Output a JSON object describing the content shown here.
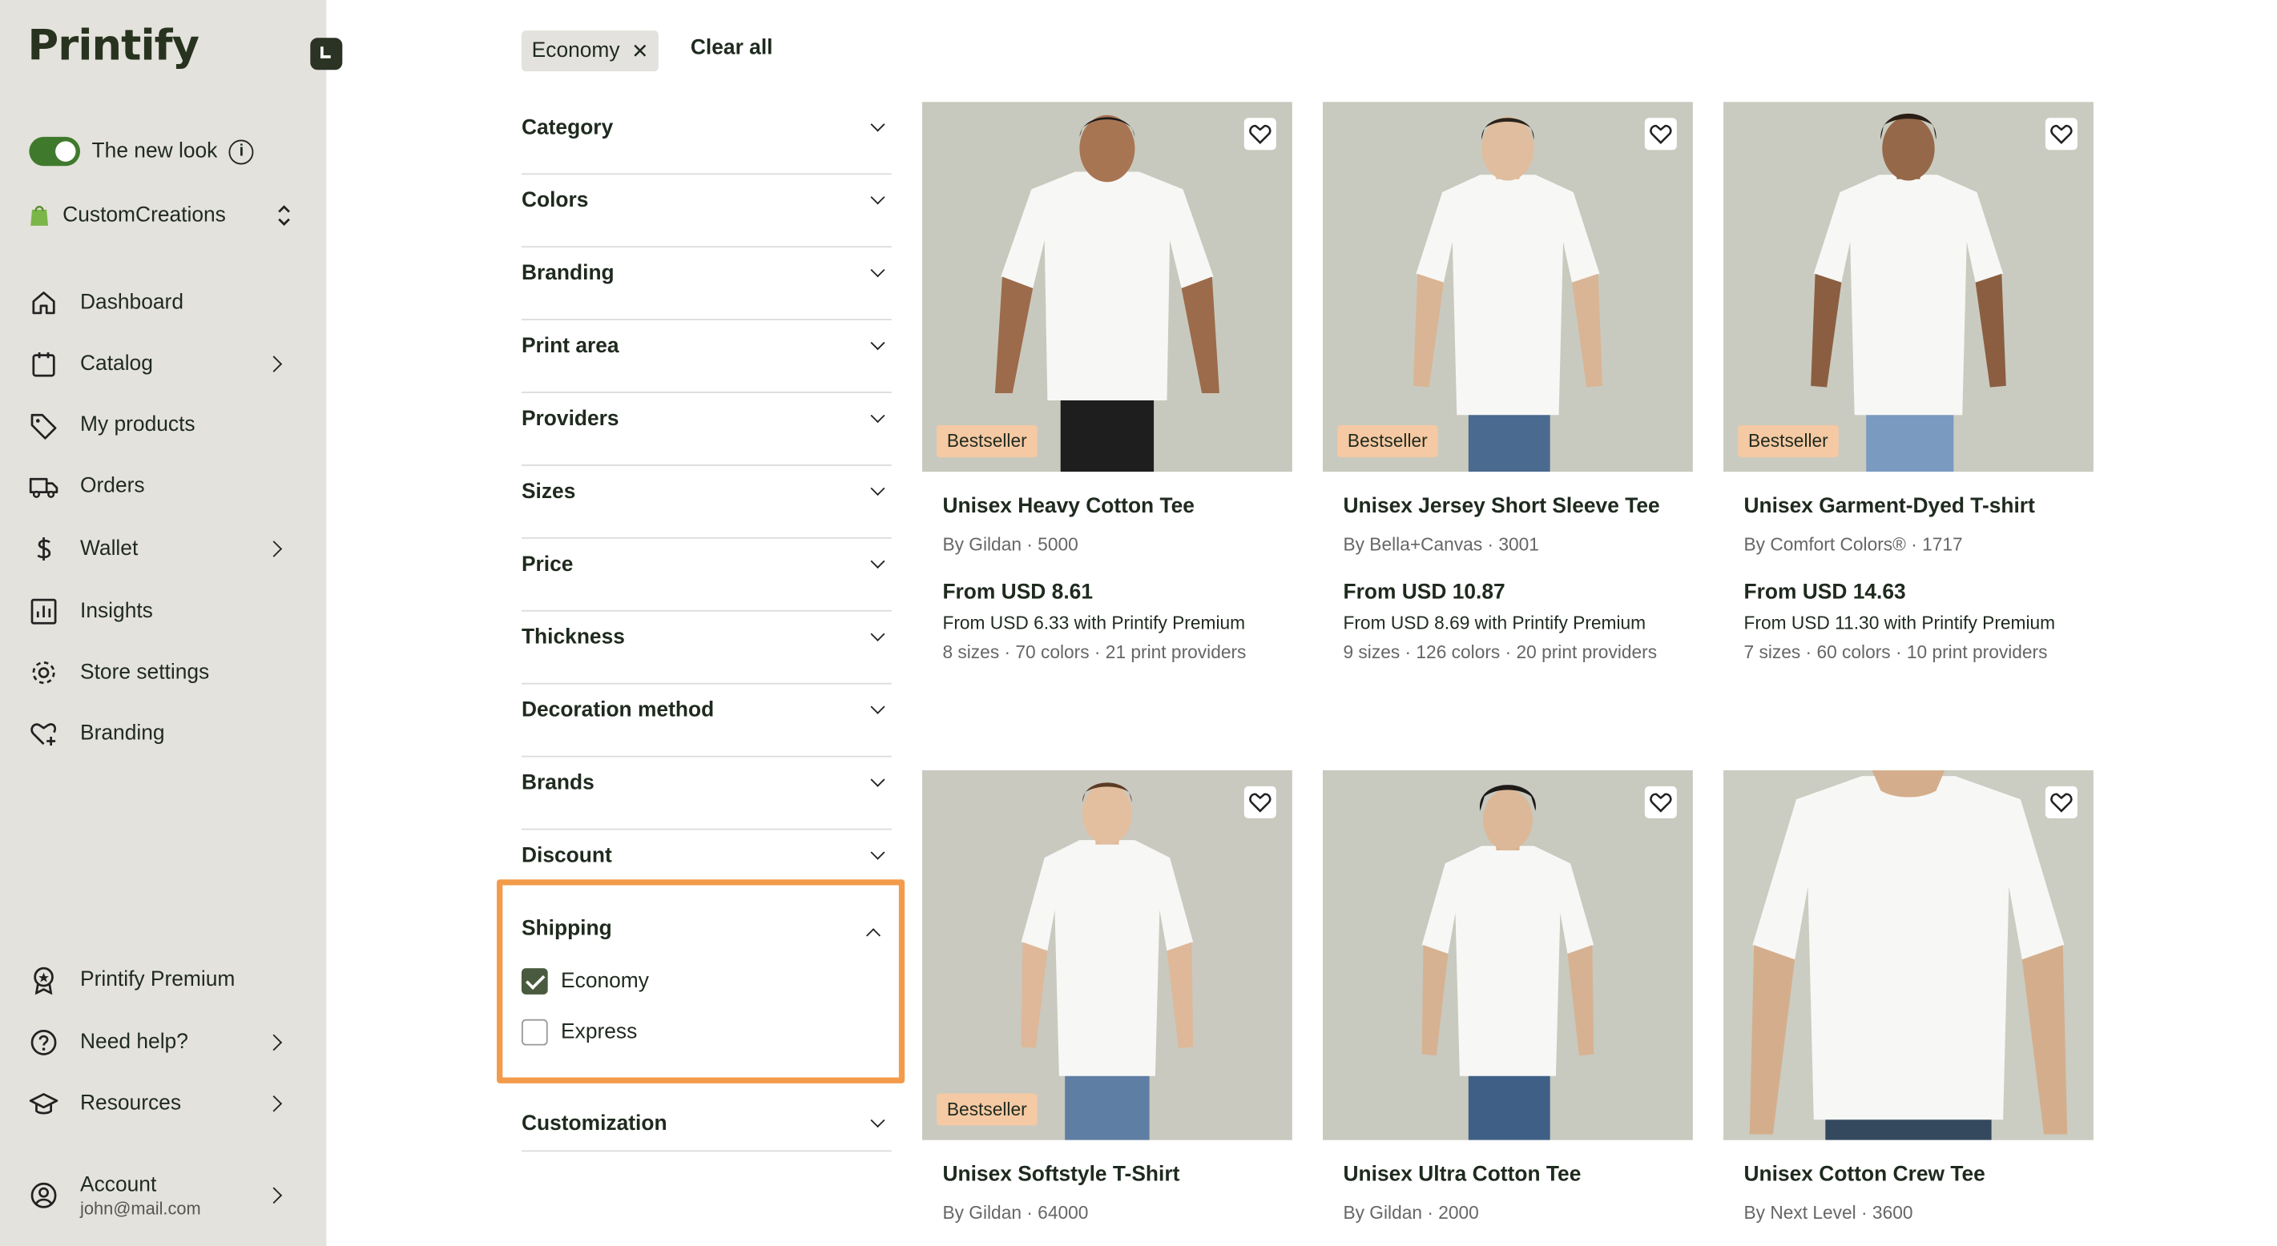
{
  "sidebar": {
    "logo": "Printify",
    "new_look_label": "The new look",
    "store_name": "CustomCreations",
    "nav": [
      {
        "label": "Dashboard"
      },
      {
        "label": "Catalog"
      },
      {
        "label": "My products"
      },
      {
        "label": "Orders"
      },
      {
        "label": "Wallet"
      },
      {
        "label": "Insights"
      },
      {
        "label": "Store settings"
      },
      {
        "label": "Branding"
      }
    ],
    "bottom_nav": [
      {
        "label": "Printify Premium"
      },
      {
        "label": "Need help?"
      },
      {
        "label": "Resources"
      }
    ],
    "account": {
      "label": "Account",
      "email": "john@mail.com"
    }
  },
  "filters": {
    "active_chip": "Economy",
    "clear_all": "Clear all",
    "sections": [
      "Category",
      "Colors",
      "Branding",
      "Print area",
      "Providers",
      "Sizes",
      "Price",
      "Thickness",
      "Decoration method",
      "Brands",
      "Discount"
    ],
    "shipping": {
      "title": "Shipping",
      "options": [
        {
          "label": "Economy",
          "checked": true
        },
        {
          "label": "Express",
          "checked": false
        }
      ]
    },
    "customization": "Customization"
  },
  "products": [
    {
      "name": "Unisex Heavy Cotton Tee",
      "by": "By Gildan · 5000",
      "price": "From USD 8.61",
      "premium": "From USD 6.33 with Printify Premium",
      "meta": "8 sizes · 70 colors · 21 print providers",
      "badge": "Bestseller"
    },
    {
      "name": "Unisex Jersey Short Sleeve Tee",
      "by": "By Bella+Canvas · 3001",
      "price": "From USD 10.87",
      "premium": "From USD 8.69 with Printify Premium",
      "meta": "9 sizes · 126 colors · 20 print providers",
      "badge": "Bestseller"
    },
    {
      "name": "Unisex Garment-Dyed T-shirt",
      "by": "By Comfort Colors® · 1717",
      "price": "From USD 14.63",
      "premium": "From USD 11.30 with Printify Premium",
      "meta": "7 sizes · 60 colors · 10 print providers",
      "badge": "Bestseller"
    },
    {
      "name": "Unisex Softstyle T-Shirt",
      "by": "By Gildan · 64000",
      "badge": "Bestseller"
    },
    {
      "name": "Unisex Ultra Cotton Tee",
      "by": "By Gildan · 2000"
    },
    {
      "name": "Unisex Cotton Crew Tee",
      "by": "By Next Level · 3600"
    }
  ],
  "colors": {
    "accent_green": "#3f7a2c",
    "highlight_orange": "#f39b4a",
    "badge": "#f5c9a3",
    "sidebar_bg": "#e4e2dc"
  }
}
